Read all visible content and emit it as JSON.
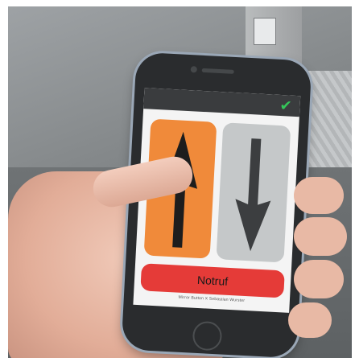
{
  "screen": {
    "emergency_button_label": "Notruf",
    "credit_text": "Mirror Button X Sebastian Wurster"
  },
  "icons": {
    "up": "arrow-up-icon",
    "down": "arrow-down-icon",
    "check": "checkmark-icon"
  },
  "colors": {
    "up_button": "#f08a3a",
    "down_button": "#c5c8c9",
    "emergency_button": "#e53b38",
    "check": "#34c759"
  }
}
